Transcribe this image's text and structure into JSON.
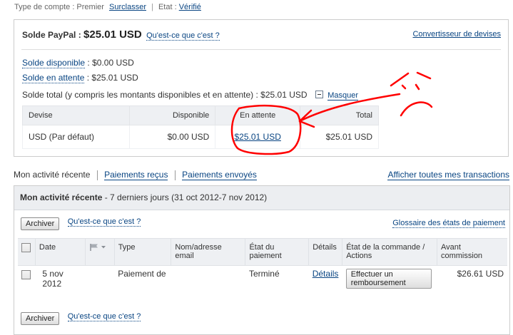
{
  "account": {
    "type_label": "Type de compte : Premier",
    "upgrade_link": "Surclasser",
    "status_label": "Etat :",
    "status_value": "Vérifié"
  },
  "balance": {
    "title": "Solde PayPal :",
    "amount": "$25.01 USD",
    "whats_this": "Qu'est-ce que c'est ?",
    "converter_link": "Convertisseur de devises",
    "available_label": "Solde disponible",
    "available_value": ": $0.00 USD",
    "pending_label": "Solde en attente",
    "pending_value": ": $25.01 USD",
    "total_text": "Solde total (y compris les montants disponibles et en attente) : $25.01 USD",
    "hide_link": "Masquer",
    "table": {
      "headers": [
        "Devise",
        "Disponible",
        "En attente",
        "Total"
      ],
      "rows": [
        {
          "currency": "USD (Par défaut)",
          "available": "$0.00 USD",
          "pending": "$25.01 USD",
          "total": "$25.01 USD"
        }
      ]
    }
  },
  "tabs": {
    "current": "Mon activité récente",
    "received": "Paiements reçus",
    "sent": "Paiements envoyés",
    "all_transactions": "Afficher toutes mes transactions"
  },
  "activity": {
    "title": "Mon activité récente",
    "subtitle": " - 7 derniers jours (31 oct 2012-7 nov 2012)",
    "archive_label": "Archiver",
    "whats_this": "Qu'est-ce que c'est ?",
    "glossary_link": "Glossaire des états de paiement",
    "columns": [
      "Date",
      "Type",
      "Nom/adresse email",
      "État du paiement",
      "Détails",
      "État de la commande / Actions",
      "Avant commission"
    ],
    "rows": [
      {
        "date": "5 nov 2012",
        "type": "Paiement de",
        "name": "",
        "status": "Terminé",
        "details": "Détails",
        "action": "Effectuer un remboursement",
        "amount": "$26.61 USD"
      }
    ]
  },
  "colors": {
    "link": "#084482",
    "annotation": "#ff0000"
  }
}
